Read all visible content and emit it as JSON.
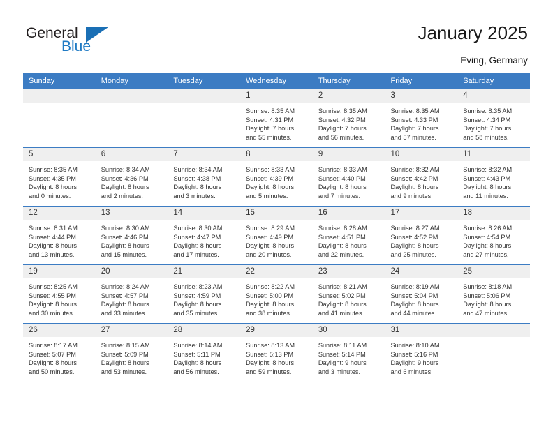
{
  "brand": {
    "name_dark": "General",
    "name_blue": "Blue",
    "color_dark": "#231f20",
    "color_blue": "#1f7ac4"
  },
  "header": {
    "title": "January 2025",
    "subtitle": "Eving, Germany"
  },
  "theme": {
    "header_blue": "#3c7cc3",
    "daynum_bg": "#efefef",
    "cell_bg": "#ffffff",
    "text": "#333333"
  },
  "calendar": {
    "weekday_headers": [
      "Sunday",
      "Monday",
      "Tuesday",
      "Wednesday",
      "Thursday",
      "Friday",
      "Saturday"
    ],
    "weeks": [
      [
        {
          "day": "",
          "empty": true
        },
        {
          "day": "",
          "empty": true
        },
        {
          "day": "",
          "empty": true
        },
        {
          "day": "1",
          "sunrise": "Sunrise: 8:35 AM",
          "sunset": "Sunset: 4:31 PM",
          "daylight1": "Daylight: 7 hours",
          "daylight2": "and 55 minutes."
        },
        {
          "day": "2",
          "sunrise": "Sunrise: 8:35 AM",
          "sunset": "Sunset: 4:32 PM",
          "daylight1": "Daylight: 7 hours",
          "daylight2": "and 56 minutes."
        },
        {
          "day": "3",
          "sunrise": "Sunrise: 8:35 AM",
          "sunset": "Sunset: 4:33 PM",
          "daylight1": "Daylight: 7 hours",
          "daylight2": "and 57 minutes."
        },
        {
          "day": "4",
          "sunrise": "Sunrise: 8:35 AM",
          "sunset": "Sunset: 4:34 PM",
          "daylight1": "Daylight: 7 hours",
          "daylight2": "and 58 minutes."
        }
      ],
      [
        {
          "day": "5",
          "sunrise": "Sunrise: 8:35 AM",
          "sunset": "Sunset: 4:35 PM",
          "daylight1": "Daylight: 8 hours",
          "daylight2": "and 0 minutes."
        },
        {
          "day": "6",
          "sunrise": "Sunrise: 8:34 AM",
          "sunset": "Sunset: 4:36 PM",
          "daylight1": "Daylight: 8 hours",
          "daylight2": "and 2 minutes."
        },
        {
          "day": "7",
          "sunrise": "Sunrise: 8:34 AM",
          "sunset": "Sunset: 4:38 PM",
          "daylight1": "Daylight: 8 hours",
          "daylight2": "and 3 minutes."
        },
        {
          "day": "8",
          "sunrise": "Sunrise: 8:33 AM",
          "sunset": "Sunset: 4:39 PM",
          "daylight1": "Daylight: 8 hours",
          "daylight2": "and 5 minutes."
        },
        {
          "day": "9",
          "sunrise": "Sunrise: 8:33 AM",
          "sunset": "Sunset: 4:40 PM",
          "daylight1": "Daylight: 8 hours",
          "daylight2": "and 7 minutes."
        },
        {
          "day": "10",
          "sunrise": "Sunrise: 8:32 AM",
          "sunset": "Sunset: 4:42 PM",
          "daylight1": "Daylight: 8 hours",
          "daylight2": "and 9 minutes."
        },
        {
          "day": "11",
          "sunrise": "Sunrise: 8:32 AM",
          "sunset": "Sunset: 4:43 PM",
          "daylight1": "Daylight: 8 hours",
          "daylight2": "and 11 minutes."
        }
      ],
      [
        {
          "day": "12",
          "sunrise": "Sunrise: 8:31 AM",
          "sunset": "Sunset: 4:44 PM",
          "daylight1": "Daylight: 8 hours",
          "daylight2": "and 13 minutes."
        },
        {
          "day": "13",
          "sunrise": "Sunrise: 8:30 AM",
          "sunset": "Sunset: 4:46 PM",
          "daylight1": "Daylight: 8 hours",
          "daylight2": "and 15 minutes."
        },
        {
          "day": "14",
          "sunrise": "Sunrise: 8:30 AM",
          "sunset": "Sunset: 4:47 PM",
          "daylight1": "Daylight: 8 hours",
          "daylight2": "and 17 minutes."
        },
        {
          "day": "15",
          "sunrise": "Sunrise: 8:29 AM",
          "sunset": "Sunset: 4:49 PM",
          "daylight1": "Daylight: 8 hours",
          "daylight2": "and 20 minutes."
        },
        {
          "day": "16",
          "sunrise": "Sunrise: 8:28 AM",
          "sunset": "Sunset: 4:51 PM",
          "daylight1": "Daylight: 8 hours",
          "daylight2": "and 22 minutes."
        },
        {
          "day": "17",
          "sunrise": "Sunrise: 8:27 AM",
          "sunset": "Sunset: 4:52 PM",
          "daylight1": "Daylight: 8 hours",
          "daylight2": "and 25 minutes."
        },
        {
          "day": "18",
          "sunrise": "Sunrise: 8:26 AM",
          "sunset": "Sunset: 4:54 PM",
          "daylight1": "Daylight: 8 hours",
          "daylight2": "and 27 minutes."
        }
      ],
      [
        {
          "day": "19",
          "sunrise": "Sunrise: 8:25 AM",
          "sunset": "Sunset: 4:55 PM",
          "daylight1": "Daylight: 8 hours",
          "daylight2": "and 30 minutes."
        },
        {
          "day": "20",
          "sunrise": "Sunrise: 8:24 AM",
          "sunset": "Sunset: 4:57 PM",
          "daylight1": "Daylight: 8 hours",
          "daylight2": "and 33 minutes."
        },
        {
          "day": "21",
          "sunrise": "Sunrise: 8:23 AM",
          "sunset": "Sunset: 4:59 PM",
          "daylight1": "Daylight: 8 hours",
          "daylight2": "and 35 minutes."
        },
        {
          "day": "22",
          "sunrise": "Sunrise: 8:22 AM",
          "sunset": "Sunset: 5:00 PM",
          "daylight1": "Daylight: 8 hours",
          "daylight2": "and 38 minutes."
        },
        {
          "day": "23",
          "sunrise": "Sunrise: 8:21 AM",
          "sunset": "Sunset: 5:02 PM",
          "daylight1": "Daylight: 8 hours",
          "daylight2": "and 41 minutes."
        },
        {
          "day": "24",
          "sunrise": "Sunrise: 8:19 AM",
          "sunset": "Sunset: 5:04 PM",
          "daylight1": "Daylight: 8 hours",
          "daylight2": "and 44 minutes."
        },
        {
          "day": "25",
          "sunrise": "Sunrise: 8:18 AM",
          "sunset": "Sunset: 5:06 PM",
          "daylight1": "Daylight: 8 hours",
          "daylight2": "and 47 minutes."
        }
      ],
      [
        {
          "day": "26",
          "sunrise": "Sunrise: 8:17 AM",
          "sunset": "Sunset: 5:07 PM",
          "daylight1": "Daylight: 8 hours",
          "daylight2": "and 50 minutes."
        },
        {
          "day": "27",
          "sunrise": "Sunrise: 8:15 AM",
          "sunset": "Sunset: 5:09 PM",
          "daylight1": "Daylight: 8 hours",
          "daylight2": "and 53 minutes."
        },
        {
          "day": "28",
          "sunrise": "Sunrise: 8:14 AM",
          "sunset": "Sunset: 5:11 PM",
          "daylight1": "Daylight: 8 hours",
          "daylight2": "and 56 minutes."
        },
        {
          "day": "29",
          "sunrise": "Sunrise: 8:13 AM",
          "sunset": "Sunset: 5:13 PM",
          "daylight1": "Daylight: 8 hours",
          "daylight2": "and 59 minutes."
        },
        {
          "day": "30",
          "sunrise": "Sunrise: 8:11 AM",
          "sunset": "Sunset: 5:14 PM",
          "daylight1": "Daylight: 9 hours",
          "daylight2": "and 3 minutes."
        },
        {
          "day": "31",
          "sunrise": "Sunrise: 8:10 AM",
          "sunset": "Sunset: 5:16 PM",
          "daylight1": "Daylight: 9 hours",
          "daylight2": "and 6 minutes."
        },
        {
          "day": "",
          "empty": true
        }
      ]
    ]
  }
}
